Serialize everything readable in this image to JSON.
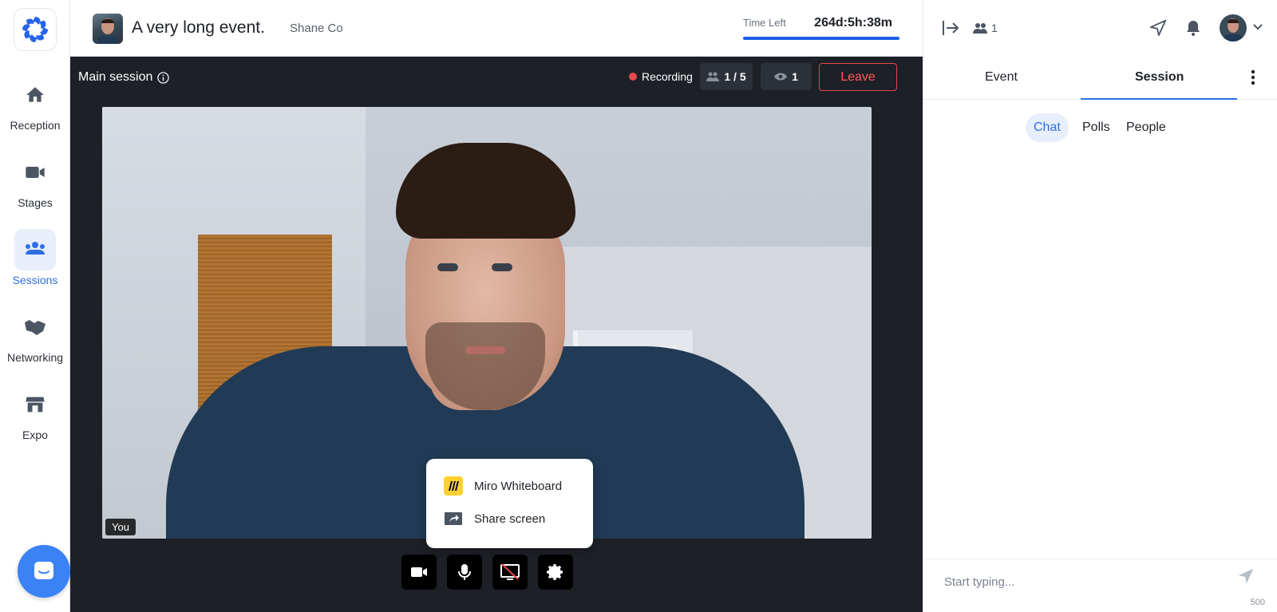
{
  "nav": {
    "items": [
      {
        "label": "Reception",
        "icon": "home-icon"
      },
      {
        "label": "Stages",
        "icon": "video-camera-icon"
      },
      {
        "label": "Sessions",
        "icon": "people-group-icon",
        "active": true
      },
      {
        "label": "Networking",
        "icon": "handshake-icon"
      },
      {
        "label": "Expo",
        "icon": "store-icon"
      }
    ]
  },
  "header": {
    "event_title": "A very long event.",
    "organizer": "Shane Co",
    "time_left_label": "Time Left",
    "time_left_value": "264d:5h:38m"
  },
  "stage": {
    "session_name": "Main session",
    "recording_label": "Recording",
    "participants": "1 / 5",
    "viewers": "1",
    "leave_label": "Leave",
    "you_label": "You"
  },
  "share_menu": {
    "items": [
      {
        "label": "Miro Whiteboard",
        "icon": "miro-icon"
      },
      {
        "label": "Share screen",
        "icon": "share-screen-icon"
      }
    ]
  },
  "right_panel": {
    "attendee_count": "1",
    "tabs": [
      "Event",
      "Session"
    ],
    "active_tab": "Session",
    "subtabs": [
      "Chat",
      "Polls",
      "People"
    ],
    "active_subtab": "Chat",
    "chat_placeholder": "Start typing...",
    "char_limit": "500"
  },
  "colors": {
    "accent": "#2f6fe4",
    "stage_bg": "#1d2026",
    "leave_red": "#e5484d"
  }
}
